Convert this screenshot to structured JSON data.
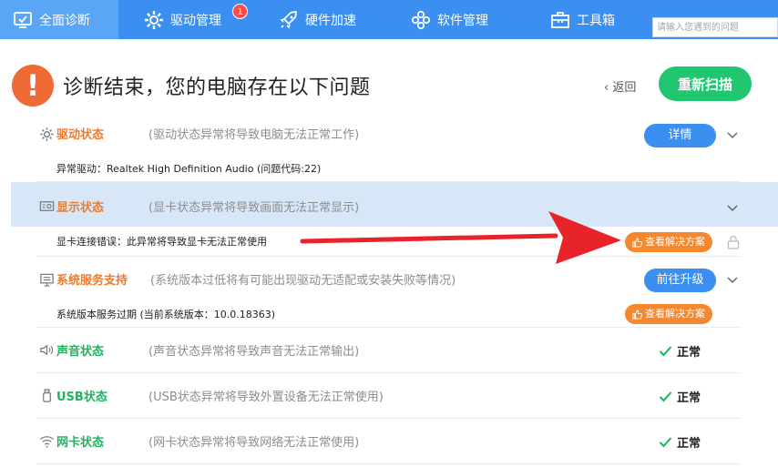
{
  "nav": {
    "tabs": [
      {
        "label": "全面诊断"
      },
      {
        "label": "驱动管理"
      },
      {
        "label": "硬件加速"
      },
      {
        "label": "软件管理"
      },
      {
        "label": "工具箱"
      }
    ],
    "badge": "1",
    "search_placeholder": "请输入您遇到的问题"
  },
  "header": {
    "alert_glyph": "!",
    "title": "诊断结束，您的电脑存在以下问题",
    "back": "返回",
    "rescan": "重新扫描"
  },
  "rows": [
    {
      "name": "驱动状态",
      "desc": "(驱动状态异常将导致电脑无法正常工作)",
      "detail": "异常驱动：Realtek High Definition Audio (问题代码:22)",
      "action": "详情"
    },
    {
      "name": "显示状态",
      "desc": "(显卡状态异常将导致画面无法正常显示)",
      "detail": "显卡连接错误：此异常将导致显卡无法正常使用",
      "action": "查看解决方案"
    },
    {
      "name": "系统服务支持",
      "desc": "(系统版本过低将有可能出现驱动无适配或安装失败等情况)",
      "detail": "系统版本服务过期 (当前系统版本：10.0.18363)",
      "action": "前往升级",
      "action2": "查看解决方案"
    },
    {
      "name": "声音状态",
      "desc": "(声音状态异常将导致声音无法正常输出)",
      "status": "正常"
    },
    {
      "name": "USB状态",
      "desc": "(USB状态异常将导致外置设备无法正常使用)",
      "status": "正常"
    },
    {
      "name": "网卡状态",
      "desc": "(网卡状态异常将导致网络无法正常使用)",
      "status": "正常"
    }
  ],
  "colors": {
    "brand_blue": "#3a8ff0",
    "warning_orange": "#f07a2c",
    "ok_green": "#1fb45d",
    "rescan_green": "#21c670",
    "arrow_red": "#e8232a"
  }
}
